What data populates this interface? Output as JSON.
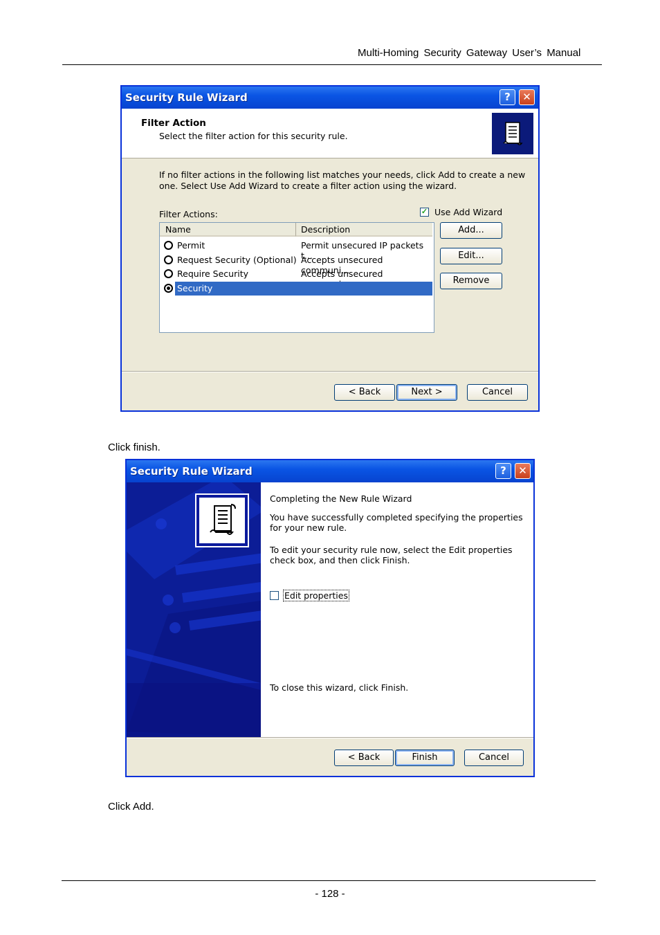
{
  "page": {
    "header": "Multi-Homing Security Gateway User’s Manual",
    "caption_finish": "Click finish.",
    "caption_add": "Click Add.",
    "page_number": "- 128 -"
  },
  "wizard1": {
    "title": "Security Rule Wizard",
    "help_glyph": "?",
    "close_glyph": "✕",
    "heading": "Filter Action",
    "subheading": "Select the filter action for this security rule.",
    "instruction_line1": "If no filter actions in the following list matches your needs, click Add to create a new",
    "instruction_line2": "one. Select Use Add Wizard to create a filter action using the wizard.",
    "filter_actions_label": "Filter Actions:",
    "use_add_wizard": {
      "label": "Use Add Wizard",
      "checked": true
    },
    "columns": [
      "Name",
      "Description"
    ],
    "rows": [
      {
        "name": "Permit",
        "description": "Permit unsecured IP packets t...",
        "selected": false
      },
      {
        "name": "Request Security (Optional)",
        "description": "Accepts unsecured communi...",
        "selected": false
      },
      {
        "name": "Require Security",
        "description": "Accepts unsecured communi...",
        "selected": false
      },
      {
        "name": "Security",
        "description": "",
        "selected": true
      }
    ],
    "side_buttons": {
      "add": "Add...",
      "edit": "Edit...",
      "remove": "Remove"
    },
    "nav_buttons": {
      "back": "< Back",
      "next": "Next >",
      "cancel": "Cancel"
    }
  },
  "wizard2": {
    "title": "Security Rule Wizard",
    "help_glyph": "?",
    "close_glyph": "✕",
    "heading": "Completing the New Rule Wizard",
    "para1_line1": "You have successfully completed specifying the properties",
    "para1_line2": "for your new rule.",
    "para2_line1": "To edit your security rule now, select the Edit properties",
    "para2_line2": "check box, and then click Finish.",
    "edit_properties": {
      "label": "Edit properties",
      "checked": false
    },
    "close_text": "To close this wizard, click Finish.",
    "nav_buttons": {
      "back": "< Back",
      "finish": "Finish",
      "cancel": "Cancel"
    }
  },
  "colors": {
    "xp_title_blue": "#0a55e4",
    "dialog_face": "#ece9d8",
    "selection_blue": "#316ac5",
    "banner_navy": "#0b1a9c"
  },
  "icons": [
    "help-icon",
    "close-icon",
    "scroll-document-icon",
    "radio-button-icon",
    "checkbox-icon"
  ]
}
